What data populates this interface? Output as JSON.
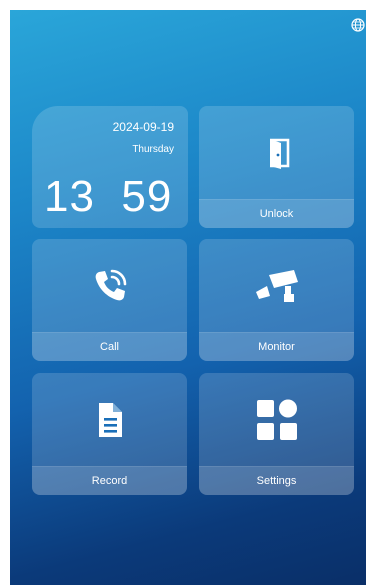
{
  "clock": {
    "date": "2024-09-19",
    "weekday": "Thursday",
    "time": "13  59"
  },
  "tiles": {
    "unlock": {
      "label": "Unlock",
      "icon": "door-icon"
    },
    "call": {
      "label": "Call",
      "icon": "phone-icon"
    },
    "monitor": {
      "label": "Monitor",
      "icon": "camera-icon"
    },
    "record": {
      "label": "Record",
      "icon": "document-icon"
    },
    "settings": {
      "label": "Settings",
      "icon": "grid-icon"
    }
  },
  "status": {
    "icon": "globe-icon"
  },
  "colors": {
    "gradient_top": "#2aa6d9",
    "gradient_bottom": "#0a2f68",
    "tile_bg": "rgba(255,255,255,0.16)",
    "text": "#ffffff"
  }
}
